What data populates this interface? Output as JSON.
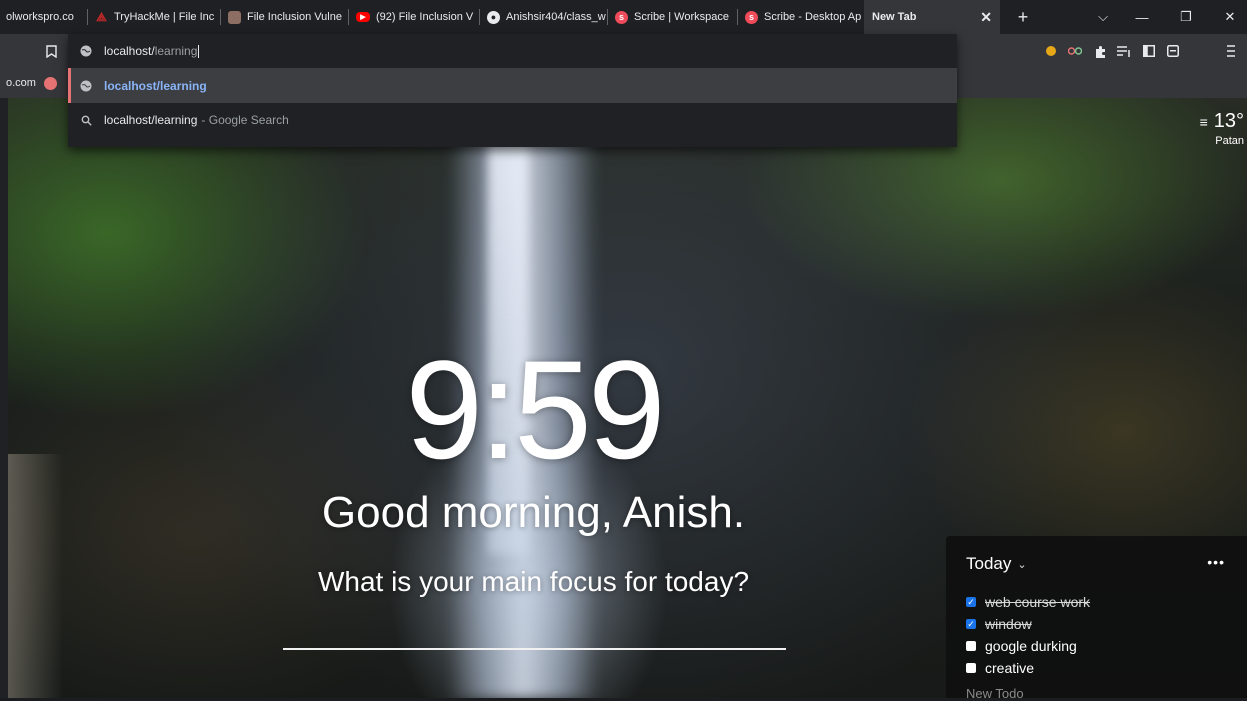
{
  "tabs": [
    {
      "label": "olworkspro.co",
      "favicon": "none",
      "color": "#1f2023"
    },
    {
      "label": "TryHackMe | File Inc",
      "favicon": "tryhackme-icon",
      "color": "#c62828"
    },
    {
      "label": "File Inclusion Vulne",
      "favicon": "page-icon",
      "color": "#8d6e63"
    },
    {
      "label": "(92) File Inclusion V",
      "favicon": "youtube-icon",
      "color": "#ff0000"
    },
    {
      "label": "Anishsir404/class_w",
      "favicon": "github-icon",
      "color": "#e8eaed"
    },
    {
      "label": "Scribe | Workspace",
      "favicon": "scribe-icon",
      "color": "#ef4b5a"
    },
    {
      "label": "Scribe - Desktop Ap",
      "favicon": "scribe-icon",
      "color": "#ef4b5a"
    },
    {
      "label": "New Tab",
      "favicon": "none",
      "active": true
    }
  ],
  "window_controls": {
    "new_tab": "+",
    "tab_search": "⌵",
    "minimize": "—",
    "restore": "❐",
    "close": "✕",
    "tab_close": "✕"
  },
  "omnibox": {
    "typed": "localhost/",
    "autocomplete": "learning",
    "suggestions": [
      {
        "text": "localhost/learning",
        "sub": "",
        "icon": "globe-icon"
      },
      {
        "text": "localhost/learning",
        "sub": "- Google Search",
        "icon": "search-icon"
      }
    ]
  },
  "bookmarks": {
    "item": "o.com"
  },
  "weather": {
    "temp": "13°",
    "location": "Patan"
  },
  "clock": "9:59",
  "greeting": "Good morning, Anish.",
  "focus_question": "What is your main focus for today?",
  "todo": {
    "title": "Today",
    "more": "•••",
    "items": [
      {
        "text": "web course work",
        "done": true
      },
      {
        "text": "window",
        "done": true
      },
      {
        "text": "google durking",
        "done": false
      },
      {
        "text": "creative",
        "done": false
      }
    ],
    "new_placeholder": "New Todo"
  }
}
